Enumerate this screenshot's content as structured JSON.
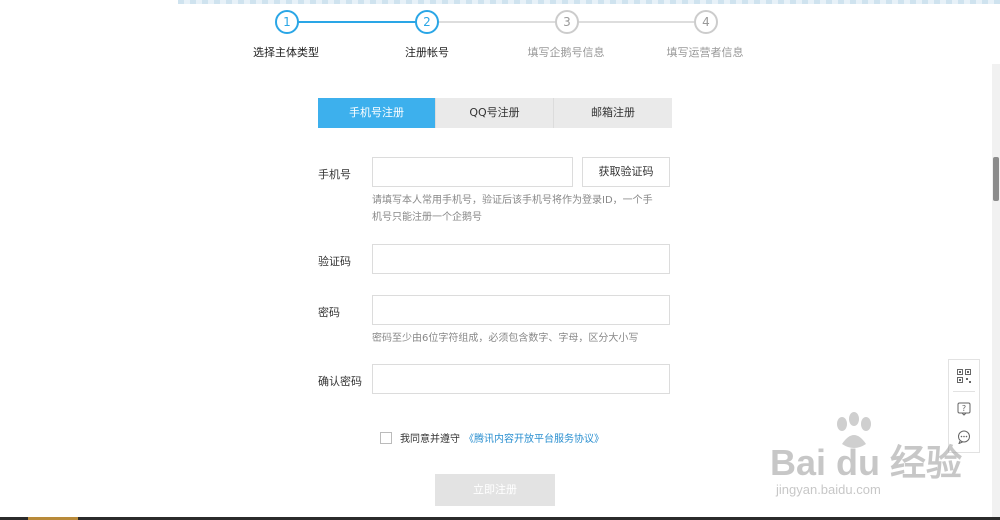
{
  "steps": [
    {
      "number": "1",
      "label": "选择主体类型",
      "state": "done"
    },
    {
      "number": "2",
      "label": "注册帐号",
      "state": "current"
    },
    {
      "number": "3",
      "label": "填写企鹅号信息",
      "state": "todo"
    },
    {
      "number": "4",
      "label": "填写运营者信息",
      "state": "todo"
    }
  ],
  "tabs": [
    {
      "label": "手机号注册",
      "active": true
    },
    {
      "label": "QQ号注册",
      "active": false
    },
    {
      "label": "邮箱注册",
      "active": false
    }
  ],
  "form": {
    "phone": {
      "label": "手机号",
      "value": "",
      "placeholder": ""
    },
    "get_code_button": "获取验证码",
    "phone_hint_line1": "请填写本人常用手机号，验证后该手机号将作为登录ID，一个手",
    "phone_hint_line2": "机号只能注册一个企鹅号",
    "code": {
      "label": "验证码",
      "value": ""
    },
    "password": {
      "label": "密码",
      "value": ""
    },
    "password_hint": "密码至少由6位字符组成，必须包含数字、字母，区分大小写",
    "confirm": {
      "label": "确认密码",
      "value": ""
    },
    "agree_text": "我同意并遵守",
    "agree_link": "《腾讯内容开放平台服务协议》",
    "agree_checked": false,
    "submit": "立即注册"
  },
  "float_bar": {
    "icons": [
      "qrcode-icon",
      "help-icon",
      "feedback-icon"
    ]
  },
  "watermark": {
    "main": "Bai du 经验",
    "sub": "jingyan.baidu.com"
  },
  "colors": {
    "accent": "#2aa6e6",
    "tab_active": "#3db0ed",
    "link": "#2a8fd0",
    "disabled_btn": "#e3e3e3"
  }
}
